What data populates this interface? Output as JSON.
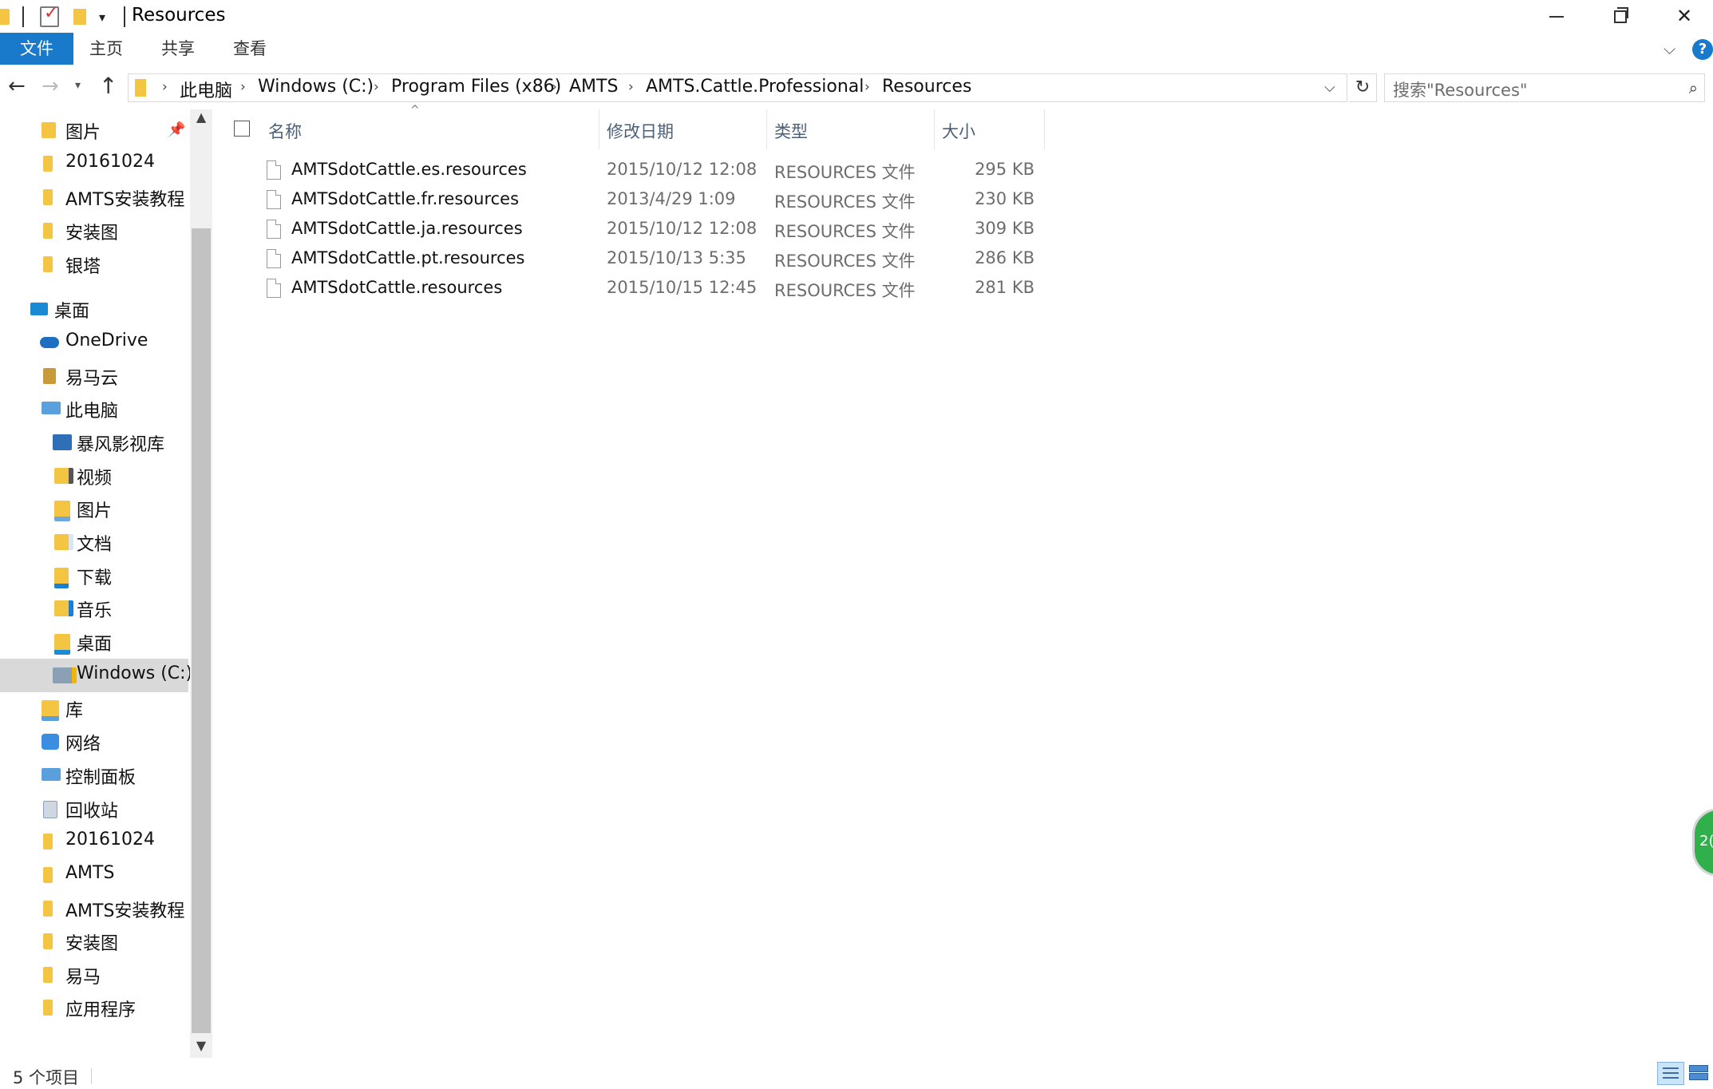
{
  "window": {
    "title": "Resources",
    "controls": [
      "minimize",
      "maximize",
      "close"
    ]
  },
  "ribbon": {
    "tabs": [
      "文件",
      "主页",
      "共享",
      "查看"
    ]
  },
  "navigation": {
    "breadcrumb": [
      "此电脑",
      "Windows (C:)",
      "Program Files (x86)",
      "AMTS",
      "AMTS.Cattle.Professional",
      "Resources"
    ],
    "search_placeholder": "搜索\"Resources\""
  },
  "sidebar": {
    "items": [
      {
        "label": "图片",
        "icon": "pictures-icon",
        "pinned": true
      },
      {
        "label": "20161024",
        "icon": "folder-icon"
      },
      {
        "label": "AMTS安装教程",
        "icon": "folder-icon"
      },
      {
        "label": "安装图",
        "icon": "folder-icon"
      },
      {
        "label": "银塔",
        "icon": "folder-icon"
      },
      {
        "label": "桌面",
        "icon": "desktop-icon"
      },
      {
        "label": "OneDrive",
        "icon": "onedrive-icon"
      },
      {
        "label": "易马云",
        "icon": "user-folder-icon"
      },
      {
        "label": "此电脑",
        "icon": "computer-icon"
      },
      {
        "label": "暴风影视库",
        "icon": "media-library-icon"
      },
      {
        "label": "视频",
        "icon": "videos-icon"
      },
      {
        "label": "图片",
        "icon": "pictures-icon"
      },
      {
        "label": "文档",
        "icon": "documents-icon"
      },
      {
        "label": "下载",
        "icon": "downloads-icon"
      },
      {
        "label": "音乐",
        "icon": "music-icon"
      },
      {
        "label": "桌面",
        "icon": "desktop-folder-icon"
      },
      {
        "label": "Windows (C:)",
        "icon": "drive-icon",
        "selected": true
      },
      {
        "label": "库",
        "icon": "library-icon"
      },
      {
        "label": "网络",
        "icon": "network-icon"
      },
      {
        "label": "控制面板",
        "icon": "control-panel-icon"
      },
      {
        "label": "回收站",
        "icon": "recycle-bin-icon"
      },
      {
        "label": "20161024",
        "icon": "folder-icon"
      },
      {
        "label": "AMTS",
        "icon": "folder-icon"
      },
      {
        "label": "AMTS安装教程",
        "icon": "folder-icon"
      },
      {
        "label": "安装图",
        "icon": "folder-icon"
      },
      {
        "label": "易马",
        "icon": "folder-icon"
      },
      {
        "label": "应用程序",
        "icon": "folder-icon"
      }
    ]
  },
  "filelist": {
    "columns": {
      "name": "名称",
      "date": "修改日期",
      "type": "类型",
      "size": "大小"
    },
    "sorted_by": "name",
    "rows": [
      {
        "name": "AMTSdotCattle.es.resources",
        "date": "2015/10/12 12:08",
        "type": "RESOURCES 文件",
        "size": "295 KB"
      },
      {
        "name": "AMTSdotCattle.fr.resources",
        "date": "2013/4/29 1:09",
        "type": "RESOURCES 文件",
        "size": "230 KB"
      },
      {
        "name": "AMTSdotCattle.ja.resources",
        "date": "2015/10/12 12:08",
        "type": "RESOURCES 文件",
        "size": "309 KB"
      },
      {
        "name": "AMTSdotCattle.pt.resources",
        "date": "2015/10/13 5:35",
        "type": "RESOURCES 文件",
        "size": "286 KB"
      },
      {
        "name": "AMTSdotCattle.resources",
        "date": "2015/10/15 12:45",
        "type": "RESOURCES 文件",
        "size": "281 KB"
      }
    ]
  },
  "status": {
    "item_count": "5 个项目"
  },
  "overlay": {
    "widget_text": "2("
  },
  "colors": {
    "accent": "#1979ca",
    "folder": "#f4c443",
    "selection": "#d9d9d9",
    "header_text": "#4c607a",
    "secondary_text": "#6d6d6d"
  }
}
